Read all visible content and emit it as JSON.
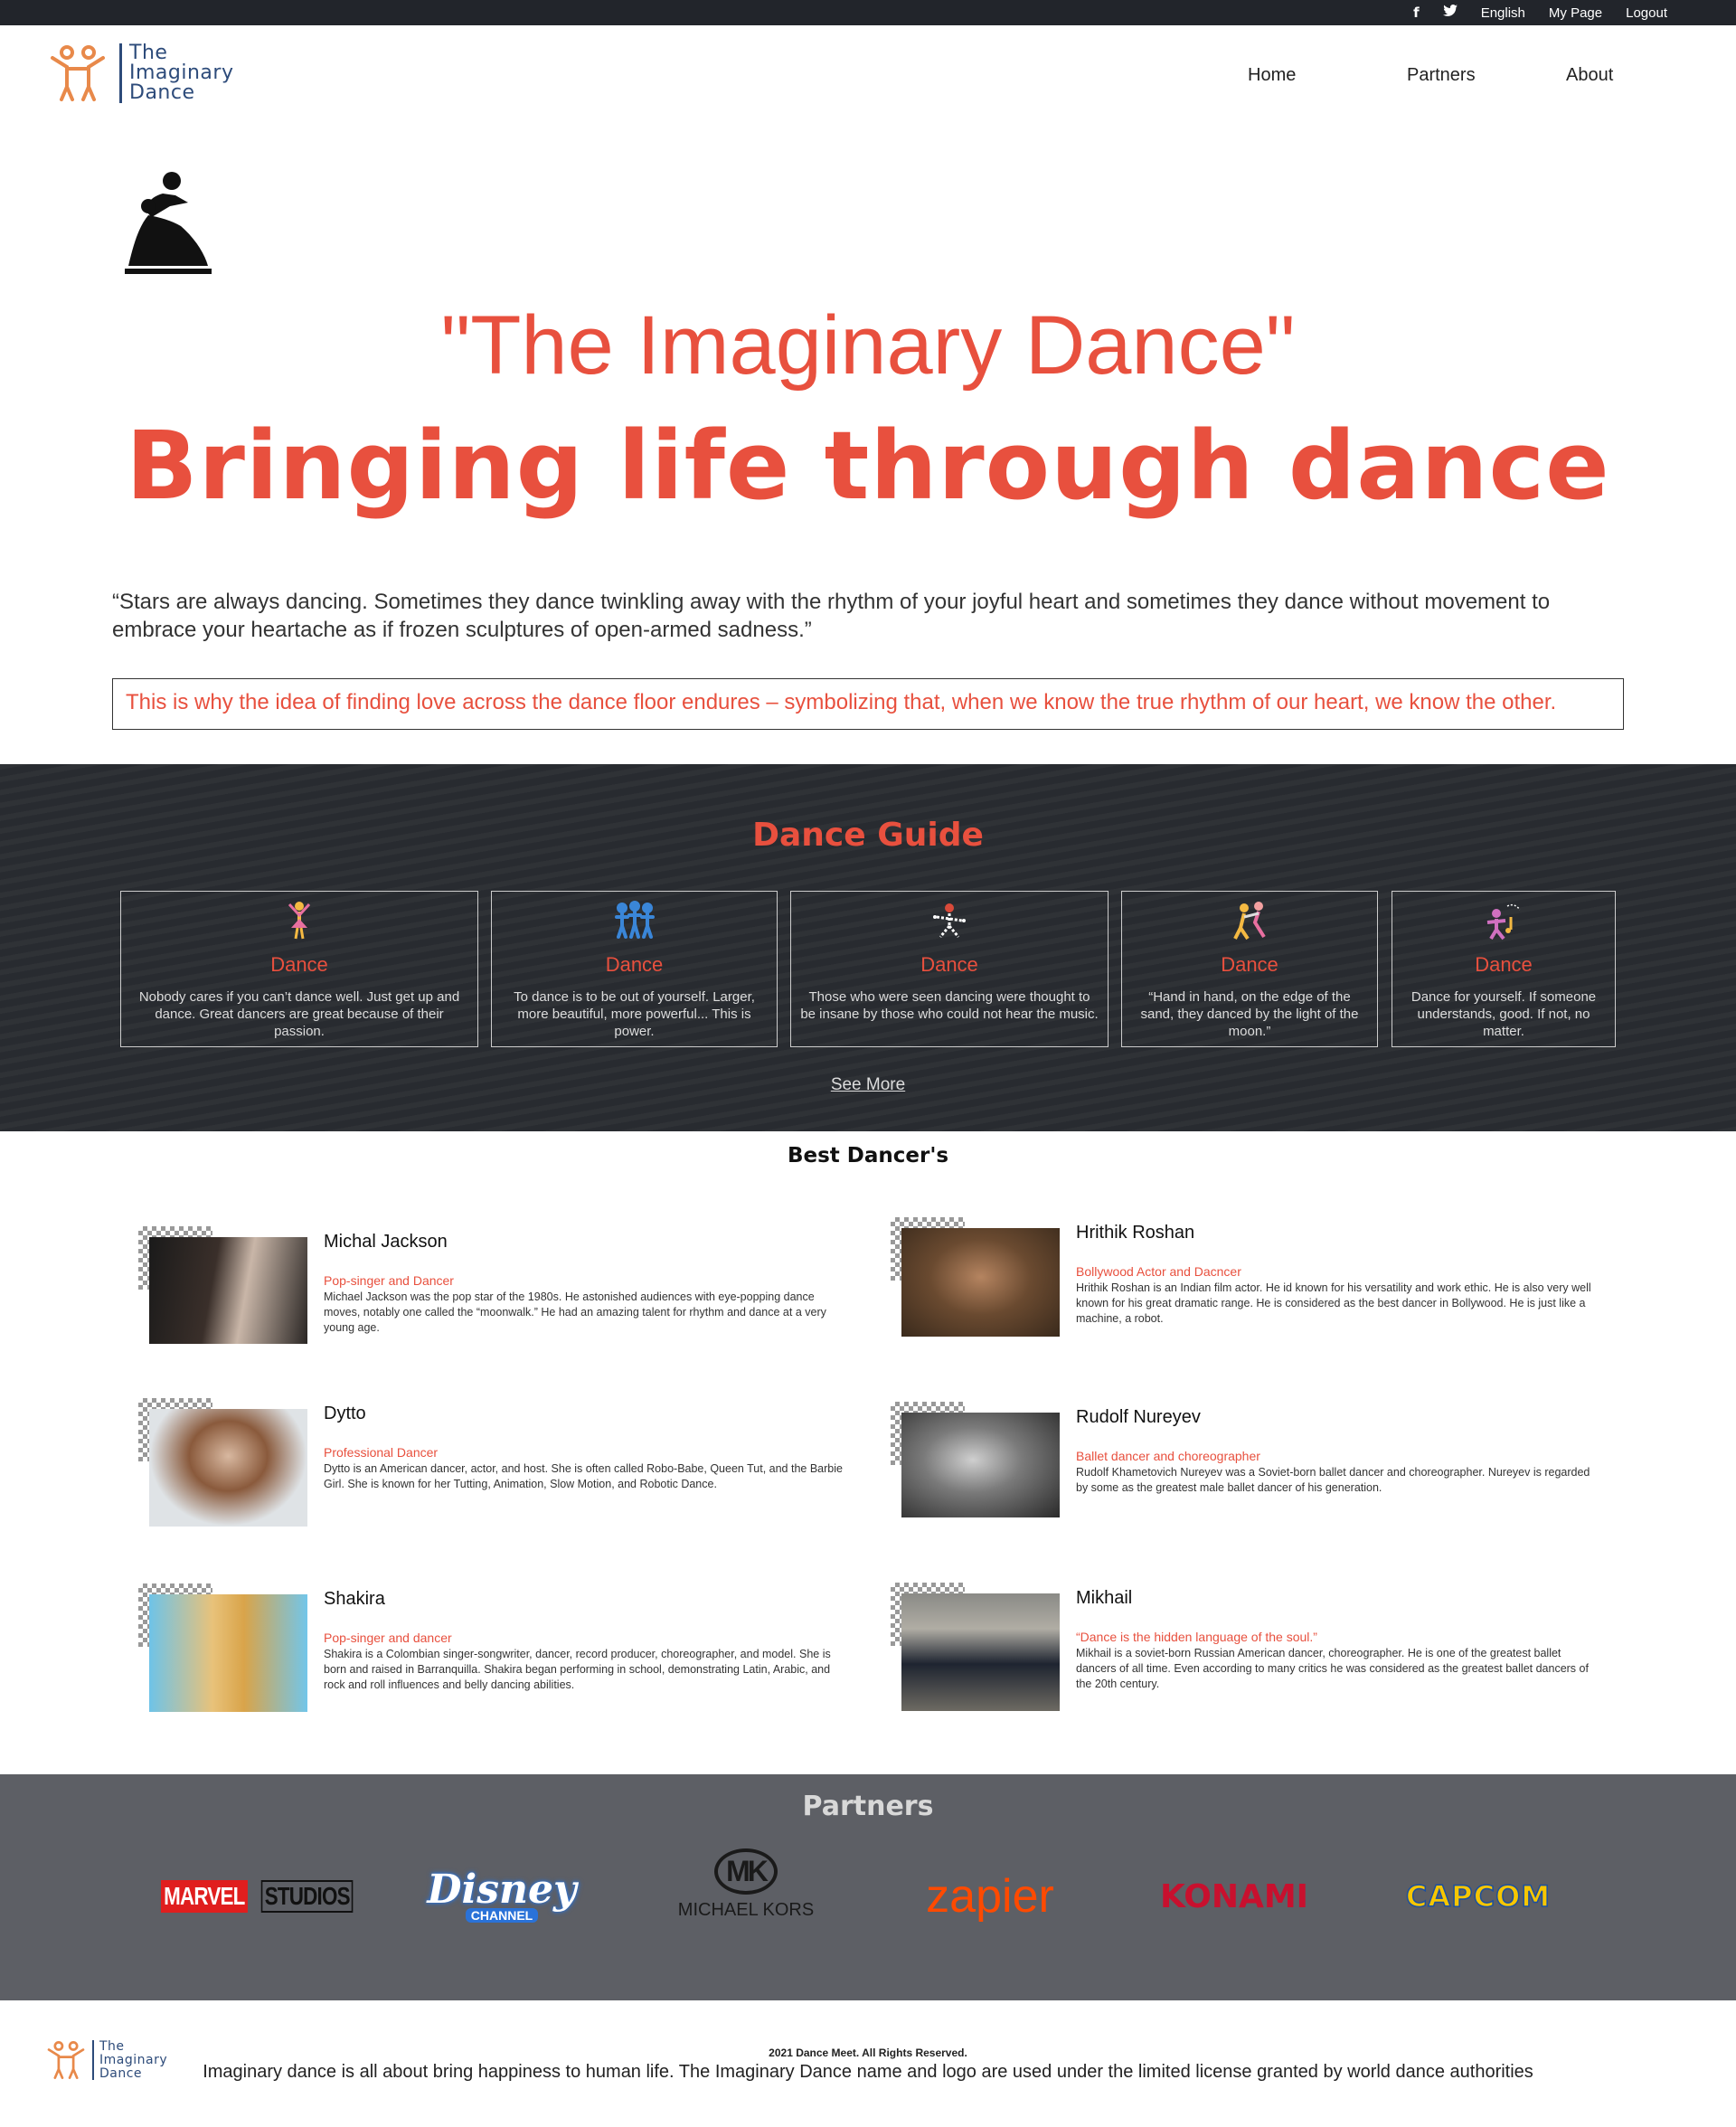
{
  "topbar": {
    "facebook": "f",
    "twitter": "t",
    "language": "English",
    "mypage": "My Page",
    "logout": "Logout"
  },
  "logo": {
    "line1": "The",
    "line2": "Imaginary",
    "line3": "Dance"
  },
  "nav": {
    "home": "Home",
    "partners": "Partners",
    "about": "About"
  },
  "hero": {
    "title": "\"The Imaginary Dance\"",
    "subtitle": "Bringing life through dance",
    "quote": "“Stars are always dancing. Sometimes they dance twinkling away with the rhythm of your joyful heart and sometimes they dance without movement to embrace your heartache as if frozen sculptures of open-armed sadness.”",
    "highlight": "This is why the idea of finding love across the dance floor endures – symbolizing that, when we know the true rhythm of our heart, we know the other."
  },
  "guide": {
    "title": "Dance Guide",
    "cards": [
      {
        "icon": "ballerina-icon",
        "title": "Dance",
        "text": "Nobody cares if you can’t dance well. Just get up and dance. Great dancers are great because of their passion."
      },
      {
        "icon": "group-dance-icon",
        "title": "Dance",
        "text": "To dance is to be out of yourself. Larger, more beautiful, more powerful... This is power."
      },
      {
        "icon": "breakdance-icon",
        "title": "Dance",
        "text": "Those who were seen dancing were thought to be insane by those who could not hear the music."
      },
      {
        "icon": "couple-dance-icon",
        "title": "Dance",
        "text": "“Hand in hand, on the edge of the sand, they danced by the light of the moon.”"
      },
      {
        "icon": "music-dance-icon",
        "title": "Dance",
        "text": "Dance for yourself. If someone understands, good. If not, no matter."
      }
    ],
    "see_more": "See More"
  },
  "best": {
    "title": "Best Dancer's",
    "dancers": [
      {
        "name": "Michal Jackson",
        "role": "Pop-singer and Dancer",
        "desc": "Michael Jackson was the pop star of the 1980s. He astonished audiences with eye-popping dance moves, notably one called the “moonwalk.” He had an amazing talent for rhythm and dance at a very young age."
      },
      {
        "name": "Hrithik Roshan",
        "role": "Bollywood Actor and Dacncer",
        "desc": "Hrithik Roshan is an Indian film actor. He id known for his versatility and work ethic. He is also very well known for his great dramatic range. He is considered as the best dancer in Bollywood. He is just like a machine, a robot."
      },
      {
        "name": "Dytto",
        "role": "Professional Dancer",
        "desc": "Dytto is an American dancer, actor, and host. She is often called Robo-Babe, Queen Tut, and the Barbie Girl. She is known for her Tutting, Animation, Slow Motion, and Robotic Dance."
      },
      {
        "name": "Rudolf Nureyev",
        "role": "Ballet dancer and choreographer",
        "desc": "Rudolf Khametovich Nureyev was a Soviet-born ballet dancer and choreographer. Nureyev is regarded by some as the greatest male ballet dancer of his generation."
      },
      {
        "name": "Shakira",
        "role": "Pop-singer and dancer",
        "desc": "Shakira is a Colombian singer-songwriter, dancer, record producer, choreographer, and model. She is born and raised in Barranquilla. Shakira began performing in school, demonstrating Latin, Arabic, and rock and roll influences and belly dancing abilities."
      },
      {
        "name": "Mikhail",
        "role": "“Dance is the hidden language of the soul.”",
        "desc": "Mikhail is a soviet-born Russian American dancer, choreographer. He is one of the greatest ballet dancers of all time. Even according to many critics he was considered as the greatest ballet dancers of the 20th century."
      }
    ]
  },
  "partners": {
    "title": "Partners",
    "logos": {
      "marvel": "MARVEL",
      "studios": "STUDIOS",
      "disney": "Disney",
      "channel": "CHANNEL",
      "mk": "MK",
      "michaelkors": "MICHAEL KORS",
      "zapier": "zapier",
      "konami": "KONAMI",
      "capcom": "CAPCOM"
    }
  },
  "footer": {
    "copyright": "2021 Dance Meet. All Rights Reserved.",
    "text": "Imaginary dance is all about bring happiness to human life. The Imaginary Dance name and logo are used under the limited license granted by world dance authorities"
  },
  "colors": {
    "accent": "#e8503e",
    "dark": "#282b30",
    "topbar": "#22252b",
    "partners_bg": "#5d5f65"
  }
}
